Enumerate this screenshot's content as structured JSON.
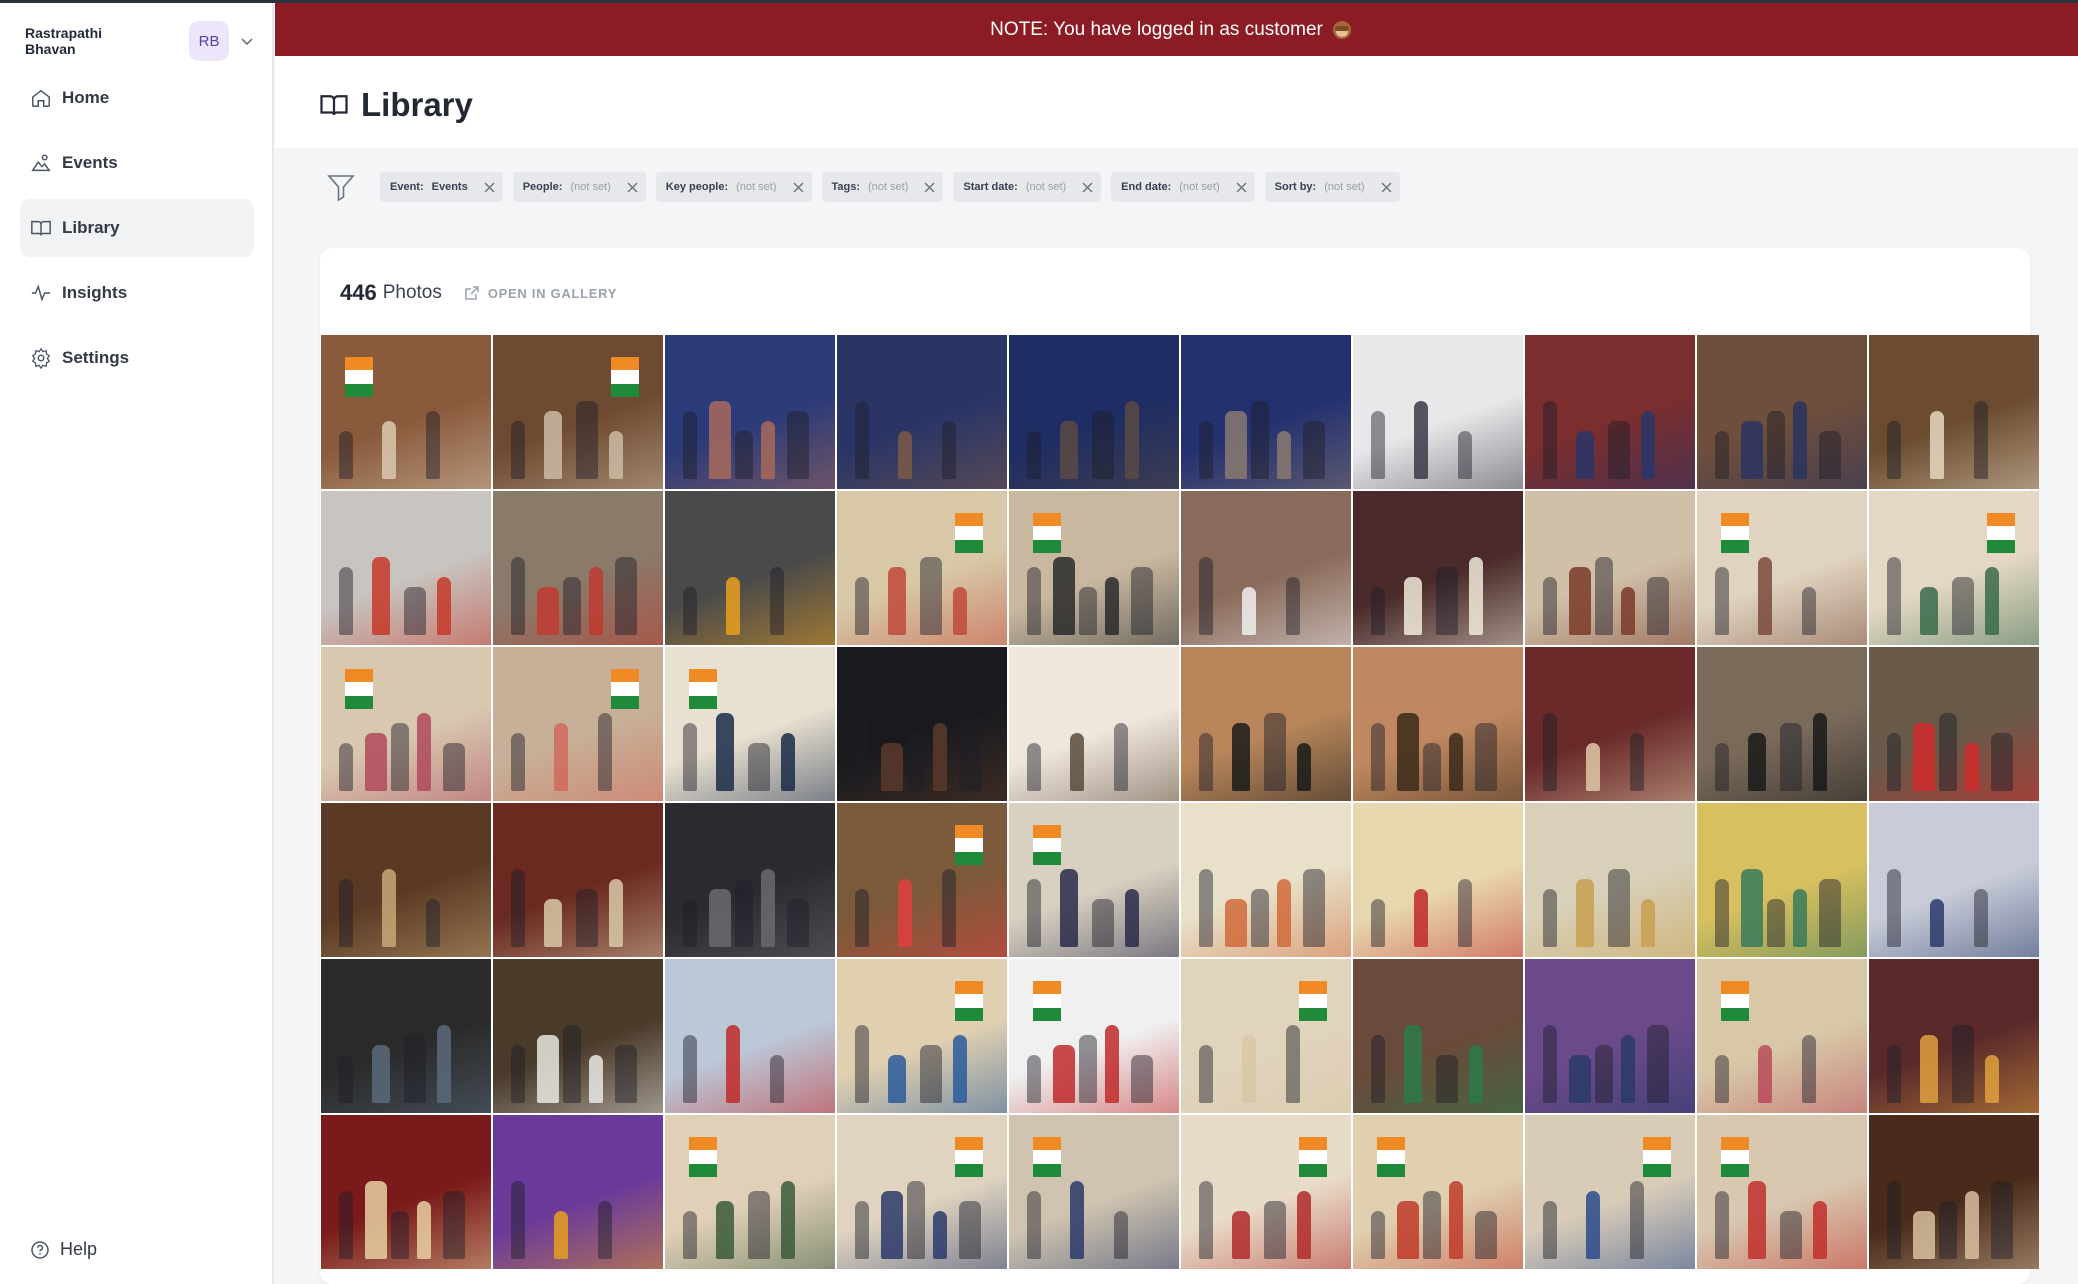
{
  "org": {
    "name": "Rastrapathi Bhavan",
    "initials": "RB"
  },
  "nav": [
    {
      "label": "Home",
      "icon": "home-icon",
      "active": false
    },
    {
      "label": "Events",
      "icon": "events-icon",
      "active": false
    },
    {
      "label": "Library",
      "icon": "book-icon",
      "active": true
    },
    {
      "label": "Insights",
      "icon": "activity-icon",
      "active": false
    },
    {
      "label": "Settings",
      "icon": "gear-icon",
      "active": false
    }
  ],
  "help_label": "Help",
  "banner": {
    "text": "NOTE: You have logged in as customer",
    "emoji": "see-no-evil-monkey",
    "color": "#8c1c24"
  },
  "page": {
    "title": "Library"
  },
  "filters": [
    {
      "key": "Event:",
      "value": "Events",
      "set": true
    },
    {
      "key": "People:",
      "value": "(not set)",
      "set": false
    },
    {
      "key": "Key people:",
      "value": "(not set)",
      "set": false
    },
    {
      "key": "Tags:",
      "value": "(not set)",
      "set": false
    },
    {
      "key": "Start date:",
      "value": "(not set)",
      "set": false
    },
    {
      "key": "End date:",
      "value": "(not set)",
      "set": false
    },
    {
      "key": "Sort by:",
      "value": "(not set)",
      "set": false
    }
  ],
  "library": {
    "count": "446",
    "count_unit": "Photos",
    "open_gallery": "OPEN IN GALLERY"
  },
  "photos": [
    [
      "#8a5a3c",
      "#d9c9b0",
      true
    ],
    [
      "#6e4a32",
      "#cdbba3",
      true
    ],
    [
      "#2b3a78",
      "#a86a5a",
      false
    ],
    [
      "#2a3566",
      "#7a5a48",
      false
    ],
    [
      "#1e2d63",
      "#5a4a44",
      false
    ],
    [
      "#243170",
      "#8a7a70",
      false
    ],
    [
      "#e8e8ea",
      "#3a3a46",
      false
    ],
    [
      "#7a2e2e",
      "#2a3568",
      false
    ],
    [
      "#6e4e3c",
      "#2a3460",
      false
    ],
    [
      "#6b4c30",
      "#e8d8c0",
      false
    ],
    [
      "#c8c4c0",
      "#c43a2a",
      false
    ],
    [
      "#8a7a6a",
      "#c03a30",
      false
    ],
    [
      "#4a4a4a",
      "#e8a020",
      false
    ],
    [
      "#d8c8a8",
      "#c04a3a",
      true
    ],
    [
      "#c8b8a0",
      "#2a2a2a",
      true
    ],
    [
      "#8a6a5a",
      "#f0f0f0",
      false
    ],
    [
      "#4a2a2a",
      "#f0ead8",
      false
    ],
    [
      "#d0c0a8",
      "#7a3a2a",
      false
    ],
    [
      "#e0d4c0",
      "#7a4a3a",
      true
    ],
    [
      "#e4d8c4",
      "#3a6a4a",
      true
    ],
    [
      "#d8c8b0",
      "#b04a5a",
      true
    ],
    [
      "#c8b098",
      "#d06a5a",
      true
    ],
    [
      "#e8e0d0",
      "#1a2a48",
      true
    ],
    [
      "#1a1a1e",
      "#5a3a2a",
      false
    ],
    [
      "#efe6dc",
      "#5a4a3a",
      false
    ],
    [
      "#b8865a",
      "#1a1a1a",
      false
    ],
    [
      "#c08860",
      "#3a2a1a",
      false
    ],
    [
      "#6a2a2a",
      "#e0c8a8",
      false
    ],
    [
      "#7a6a5a",
      "#1a1a1a",
      false
    ],
    [
      "#6a5a4a",
      "#d02a2a",
      false
    ],
    [
      "#5a3a24",
      "#c8a878",
      false
    ],
    [
      "#6a2a20",
      "#d8c8a8",
      false
    ],
    [
      "#2a2a30",
      "#6a6a70",
      false
    ],
    [
      "#7a5a3a",
      "#e04040",
      true
    ],
    [
      "#d8d0c0",
      "#2a2a4a",
      true
    ],
    [
      "#e8e0c8",
      "#d06a3a",
      false
    ],
    [
      "#e8d8b0",
      "#c02a2a",
      false
    ],
    [
      "#d8d0b8",
      "#c8a050",
      false
    ],
    [
      "#d8c060",
      "#3a7a5a",
      false
    ],
    [
      "#c8ccd8",
      "#2a3a6a",
      false
    ],
    [
      "#2a2a2a",
      "#5a6a7a",
      false
    ],
    [
      "#4a3a2a",
      "#e8e8e0",
      false
    ],
    [
      "#bcc8d8",
      "#c02a2a",
      false
    ],
    [
      "#e0d0b0",
      "#2a5a9a",
      true
    ],
    [
      "#f0f0f0",
      "#c02a2a",
      true
    ],
    [
      "#e0d4bc",
      "#d8c8a8",
      true
    ],
    [
      "#6a4a3a",
      "#2a7a4a",
      false
    ],
    [
      "#6a4a8a",
      "#2a3a6a",
      false
    ],
    [
      "#d8c8a8",
      "#b84a5a",
      true
    ],
    [
      "#5a2a2a",
      "#e0a040",
      false
    ],
    [
      "#7a1a1a",
      "#e8d0a0",
      false
    ],
    [
      "#6a3a9a",
      "#e8a020",
      false
    ],
    [
      "#e0d0b8",
      "#3a5a3a",
      true
    ],
    [
      "#e0d4c0",
      "#2a3a6a",
      true
    ],
    [
      "#d0c4b0",
      "#2a3a6a",
      true
    ],
    [
      "#e8dcc8",
      "#b02a2a",
      true
    ],
    [
      "#e0d0b0",
      "#c03a2a",
      true
    ],
    [
      "#d8ccb8",
      "#2a4a8a",
      true
    ],
    [
      "#d8c8b0",
      "#c0302a",
      true
    ],
    [
      "#4a2a1a",
      "#d8c0a0",
      false
    ]
  ]
}
